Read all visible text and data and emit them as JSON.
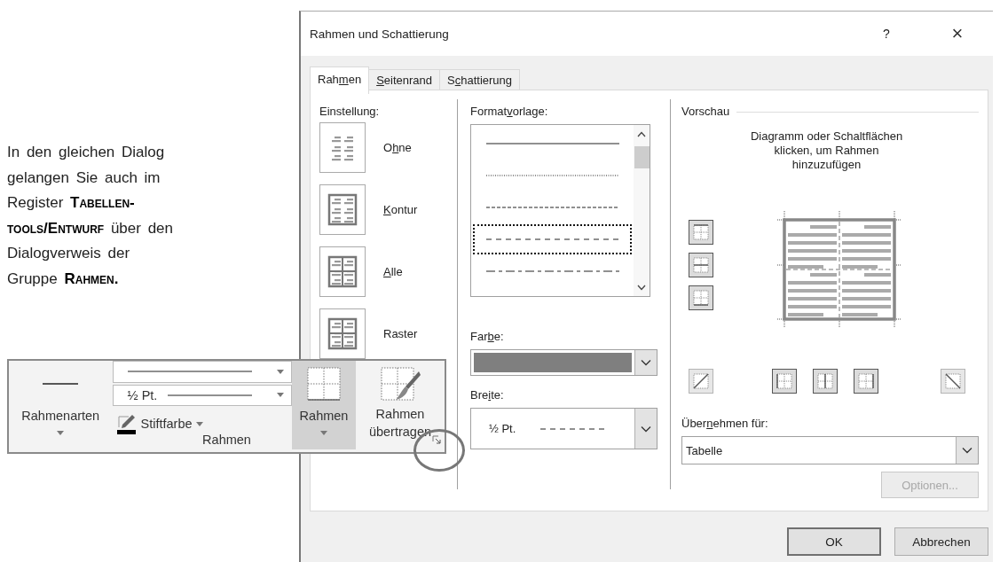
{
  "instructions": {
    "lines": [
      "In den gleichen Dialog",
      "gelangen Sie auch im",
      "Register **Tabellen-**",
      "**tools/Entwurf** über den",
      "Dialogverweis der",
      "Gruppe **Rahmen.**"
    ]
  },
  "dialog": {
    "title": "Rahmen und Schattierung",
    "help_button": "?",
    "close_button": "×",
    "tabs": [
      {
        "label": {
          "before": "Rah",
          "key": "m",
          "after": "en"
        },
        "selected": true
      },
      {
        "label": {
          "key": "S",
          "after": "eitenrand"
        },
        "selected": false
      },
      {
        "label": {
          "before": "S",
          "key": "c",
          "after": "hattierung"
        },
        "selected": false
      }
    ],
    "setting": {
      "label": "Einstellung:",
      "options": [
        {
          "kind": "none",
          "label": {
            "before": "O",
            "key": "h",
            "after": "ne"
          }
        },
        {
          "kind": "box",
          "label": {
            "key": "K",
            "after": "ontur"
          }
        },
        {
          "kind": "all",
          "label": {
            "key": "A",
            "after": "lle"
          }
        },
        {
          "kind": "grid",
          "label": "Raster"
        }
      ]
    },
    "style": {
      "label": {
        "before": "Format",
        "key": "v",
        "after": "orlage:"
      },
      "options": [
        {
          "kind": "solid",
          "selected": false
        },
        {
          "kind": "dotted",
          "selected": false
        },
        {
          "kind": "dashed-fine",
          "selected": false
        },
        {
          "kind": "dashed",
          "selected": true
        },
        {
          "kind": "dash-dot",
          "selected": false
        }
      ]
    },
    "color": {
      "label": {
        "before": "Far",
        "key": "b",
        "after": "e:"
      },
      "color": "#7f7f7f"
    },
    "width": {
      "label": {
        "before": "Bre",
        "key": "i",
        "after": "te:"
      },
      "value": "½ Pt.",
      "kind": "dashed"
    },
    "preview": {
      "title": "Vorschau",
      "hint_lines": [
        "Diagramm oder Schaltflächen",
        "klicken, um Rahmen",
        "hinzuzufügen"
      ],
      "side_buttons": [
        {
          "kind": "top",
          "pressed": true
        },
        {
          "kind": "hmid",
          "pressed": true
        },
        {
          "kind": "bottom",
          "pressed": true
        }
      ],
      "bottom_buttons": [
        {
          "kind": "diag-up",
          "pressed": false
        },
        {
          "kind": "left",
          "pressed": true
        },
        {
          "kind": "vmid",
          "pressed": true
        },
        {
          "kind": "right",
          "pressed": true
        },
        {
          "kind": "diag-down",
          "pressed": false
        }
      ]
    },
    "apply_to": {
      "label": {
        "before": "Über",
        "key": "n",
        "after": "ehmen für:"
      },
      "value": "Tabelle"
    },
    "options_button": {
      "label": "Optionen...",
      "disabled": true
    },
    "buttons": [
      {
        "label": "OK",
        "default": true
      },
      {
        "label": "Abbrechen",
        "default": false
      }
    ]
  },
  "ribbon": {
    "line_style": {
      "kind": "solid"
    },
    "line_width": {
      "value": "½ Pt.",
      "kind": "solid"
    },
    "pen_color": {
      "label": "Stiftfarbe",
      "color": "#000000"
    },
    "buttons": [
      {
        "kind": "styles",
        "label": "Rahmenarten",
        "has_menu": true,
        "selected": false
      },
      {
        "kind": "borders",
        "label": "Rahmen",
        "has_menu": true,
        "selected": true
      },
      {
        "kind": "painter",
        "label": "Rahmen übertragen",
        "has_menu": false,
        "selected": false
      }
    ],
    "group_label": "Rahmen"
  }
}
